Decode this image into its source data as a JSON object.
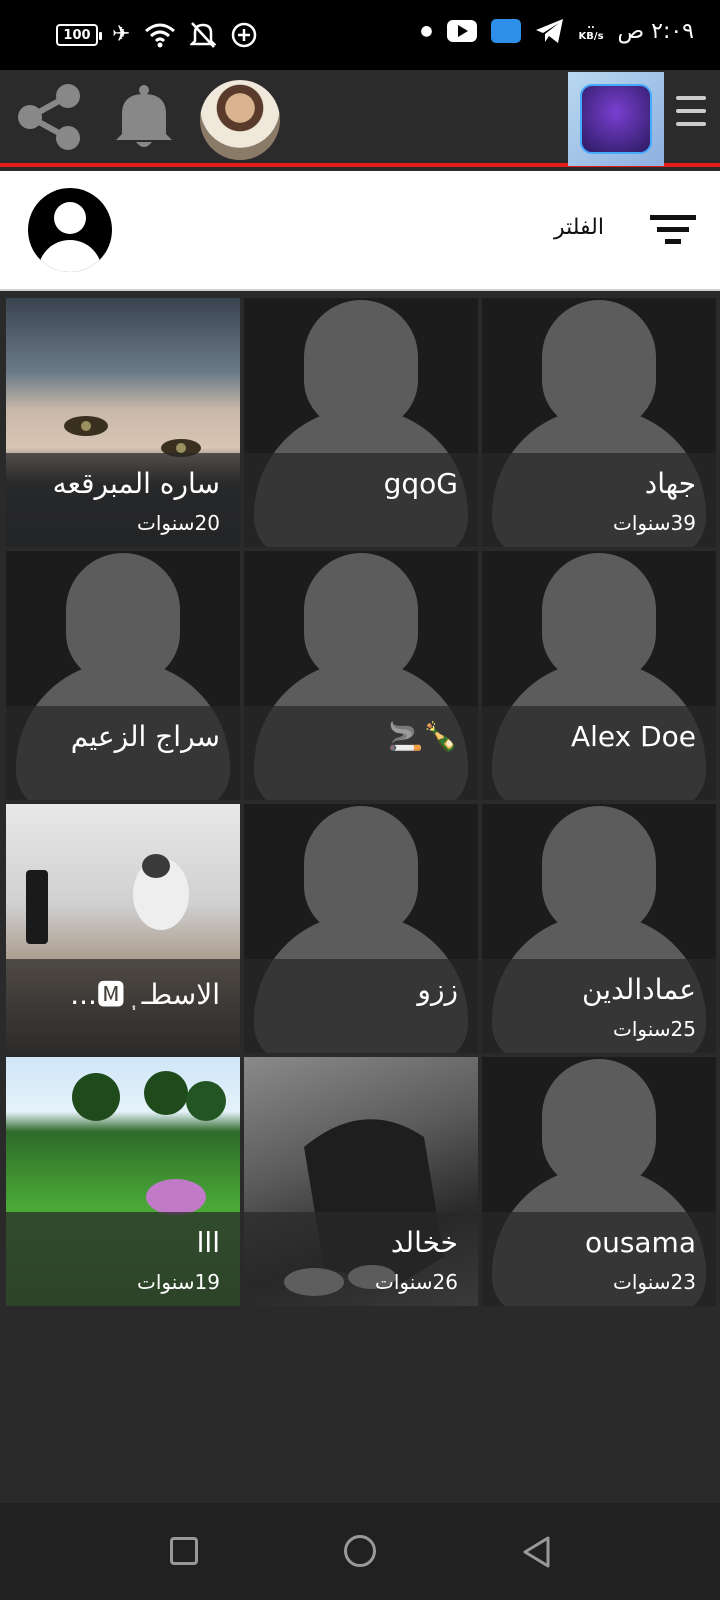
{
  "status_bar": {
    "battery": "100",
    "time": "٢:٠٩ ص",
    "speed_value": "..",
    "speed_unit": "KB/s"
  },
  "filter": {
    "label": "الفلتر"
  },
  "profiles": [
    {
      "name": "جهاد",
      "age": "39سنوات",
      "photo": "placeholder"
    },
    {
      "name": "gqoG",
      "age": "",
      "photo": "placeholder"
    },
    {
      "name": "ساره المبرقعه",
      "age": "20سنوات",
      "photo": "woman-niqab"
    },
    {
      "name": "Alex Doe",
      "age": "",
      "photo": "placeholder"
    },
    {
      "name": "🍾🚬",
      "age": "",
      "photo": "placeholder"
    },
    {
      "name": "سراج الزعيم",
      "age": "",
      "photo": "placeholder"
    },
    {
      "name": "عمادالدين",
      "age": "25سنوات",
      "photo": "placeholder"
    },
    {
      "name": "ززو",
      "age": "",
      "photo": "placeholder"
    },
    {
      "name": "الاسطـ ᷂ 🅼...",
      "age": "",
      "photo": "cat-selfie"
    },
    {
      "name": "ousama",
      "age": "23سنوات",
      "photo": "placeholder"
    },
    {
      "name": "خخالد",
      "age": "26سنوات",
      "photo": "sitting-person"
    },
    {
      "name": "lll",
      "age": "19سنوات",
      "photo": "green-landscape"
    }
  ]
}
